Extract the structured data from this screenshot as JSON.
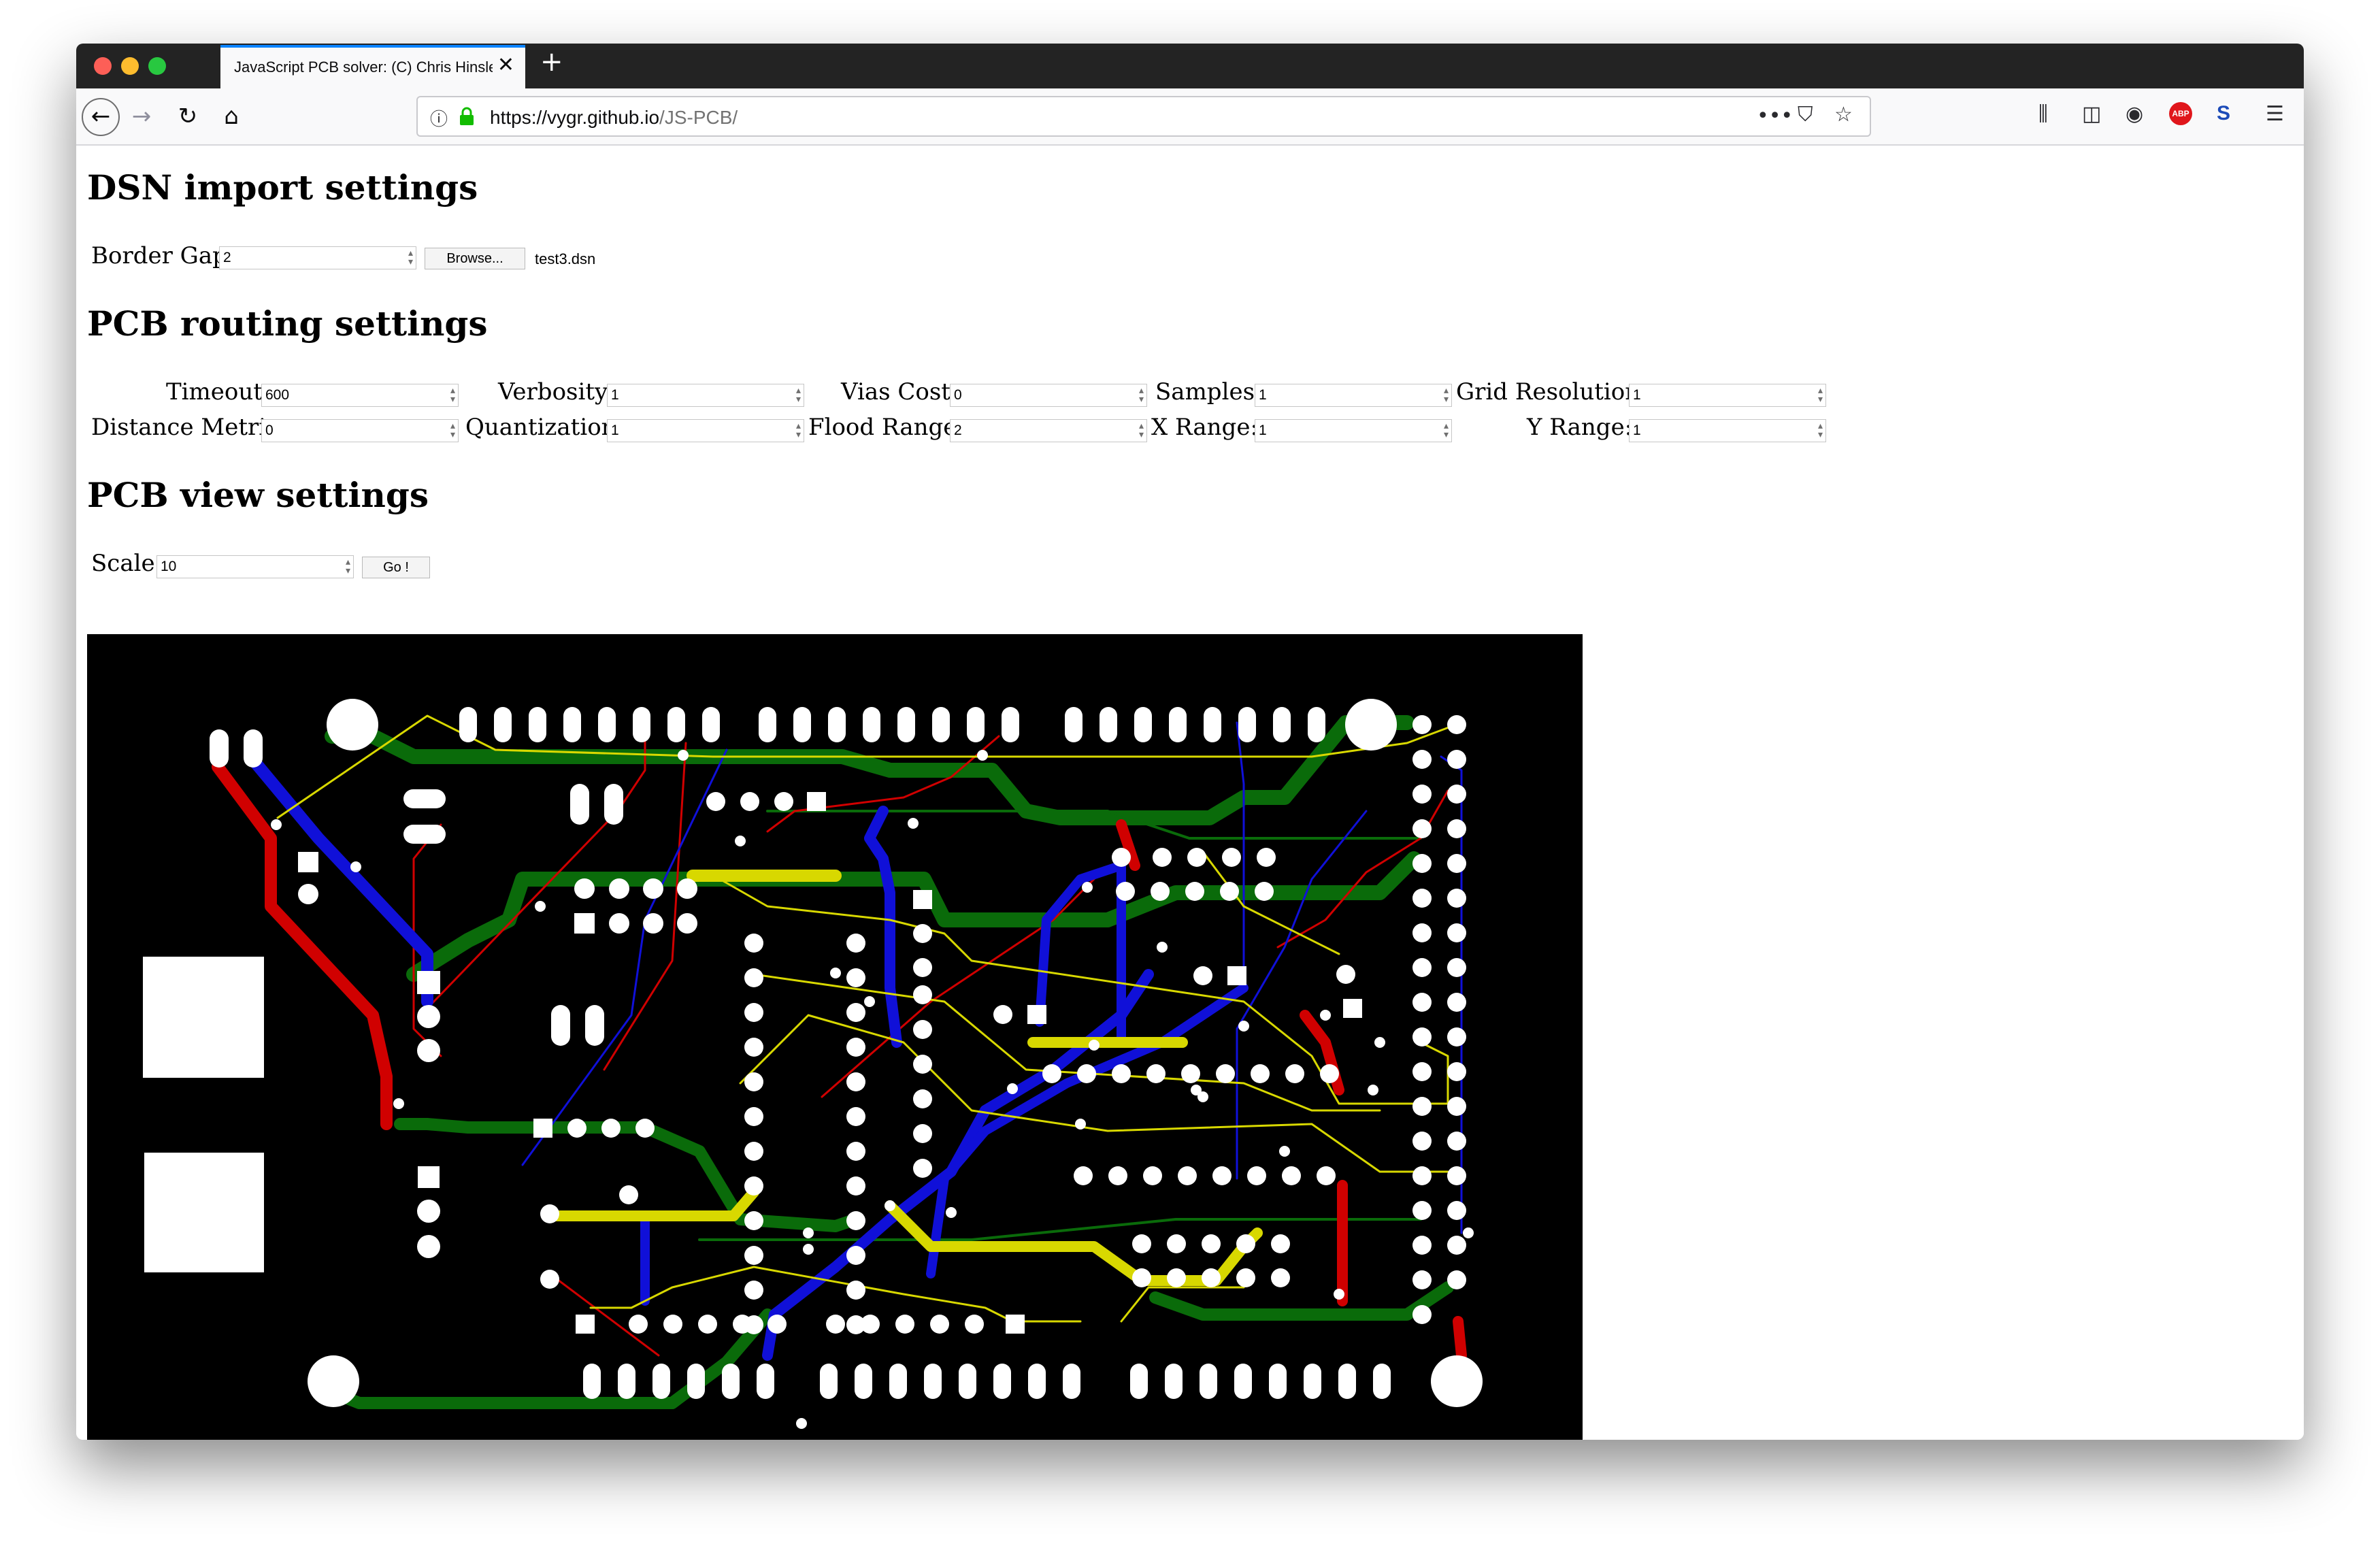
{
  "browser": {
    "tab_title": "JavaScript PCB solver: (C) Chris Hinsley",
    "url_host": "https://vygr.github.io",
    "url_path": "/JS-PCB/",
    "new_tab_glyph": "+",
    "close_glyph": "✕",
    "icons": [
      "back-icon",
      "forward-icon",
      "reload-icon",
      "home-icon",
      "info-icon",
      "lock-icon",
      "page-actions-icon",
      "pocket-icon",
      "star-icon",
      "library-icon",
      "sidebar-icon",
      "identity-icon",
      "adblock-icon",
      "s-extension-icon",
      "menu-icon"
    ]
  },
  "dsn": {
    "heading": "DSN import settings",
    "border_gap_label": "Border Gap:",
    "border_gap_value": "2",
    "browse_label": "Browse...",
    "file_name": "test3.dsn"
  },
  "routing": {
    "heading": "PCB routing settings",
    "timeout_label": "Timeout:",
    "timeout_value": "600",
    "verbosity_label": "Verbosity:",
    "verbosity_value": "1",
    "vias_cost_label": "Vias Cost:",
    "vias_cost_value": "0",
    "samples_label": "Samples:",
    "samples_value": "1",
    "grid_resolution_label": "Grid Resolution:",
    "grid_resolution_value": "1",
    "distance_metric_label": "Distance Metric:",
    "distance_metric_value": "0",
    "quantization_label": "Quantization:",
    "quantization_value": "1",
    "flood_range_label": "Flood Range:",
    "flood_range_value": "2",
    "x_range_label": "X Range:",
    "x_range_value": "1",
    "y_range_label": "Y Range:",
    "y_range_value": "1"
  },
  "view": {
    "heading": "PCB view settings",
    "scale_label": "Scale:",
    "scale_value": "10",
    "go_label": "Go !"
  },
  "colors": {
    "board": "#000000",
    "pad": "#ffffff",
    "track_red": "#d00000",
    "track_green": "#0a6b0a",
    "track_blue": "#1010d8",
    "track_yellow": "#d8d800",
    "tab_accent": "#0a84ff",
    "lock_green": "#12bc00",
    "abp_red": "#e0161b"
  }
}
